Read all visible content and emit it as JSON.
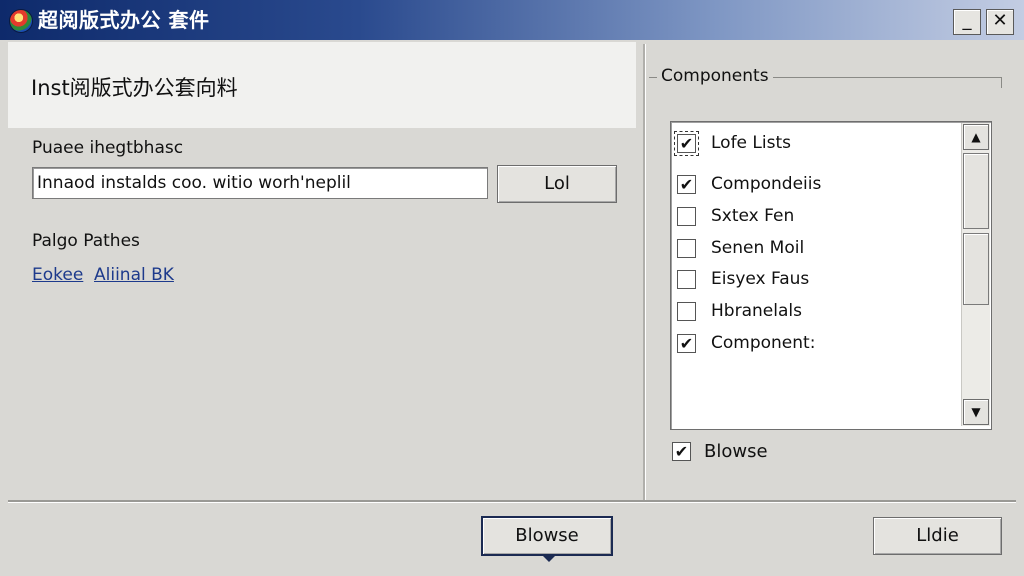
{
  "window": {
    "title": "超阅版式办公 套件",
    "minimize_glyph": "_",
    "close_glyph": "✕"
  },
  "header": {
    "title": "Inst阅版式办公套向料"
  },
  "path_section": {
    "label": "Puaee ihegtbhasc",
    "input_value": "Innaod instalds coo. witio worh'neplil",
    "list_button": "Lol"
  },
  "paths_section": {
    "label": "Palgo Pathes",
    "links": [
      "Eokee",
      "Aliinal BK"
    ]
  },
  "components": {
    "group_label": "Components",
    "items": [
      {
        "label": "Lofe  Lists",
        "checked": "✔",
        "focused": true
      },
      {
        "label": "Compondeiis",
        "checked": "✔"
      },
      {
        "label": "Sxtex Fen",
        "checked": ""
      },
      {
        "label": "Senen Moil",
        "checked": ""
      },
      {
        "label": "Eisyex Faus",
        "checked": ""
      },
      {
        "label": "Hbranelals",
        "checked": ""
      },
      {
        "label": "Component:",
        "checked": "✔"
      }
    ],
    "scroll_up": "▲",
    "scroll_down": "▼"
  },
  "bottom_option": {
    "label": "Blowse",
    "checked": "✔"
  },
  "footer": {
    "browse_button": "Blowse",
    "hide_button": "Lldie"
  },
  "colors": {
    "titlebar_start": "#0e2a6b",
    "titlebar_end": "#c3cde3",
    "link": "#1d3a8c"
  }
}
